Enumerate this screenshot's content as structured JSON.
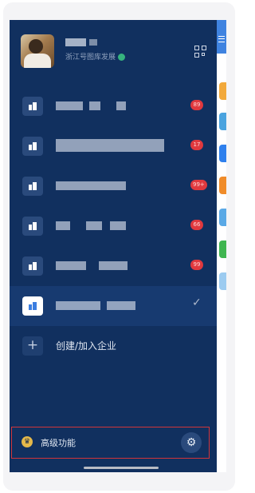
{
  "profile": {
    "company": "浙江号图库发展"
  },
  "organizations": [
    {
      "badge": "89",
      "selected": false
    },
    {
      "badge": "17",
      "selected": false
    },
    {
      "badge": "99+",
      "selected": false
    },
    {
      "badge": "66",
      "selected": false
    },
    {
      "badge": "99",
      "selected": false
    },
    {
      "badge": "",
      "selected": true
    }
  ],
  "create_org": {
    "label": "创建/加入企业"
  },
  "advanced": {
    "label": "高级功能"
  },
  "colors": {
    "drawer_bg": "#11305f",
    "selected_bg": "#173a70",
    "badge_red": "#e0393e",
    "highlight_border": "#d0353a",
    "accent_blue": "#3f83e0"
  },
  "icons": [
    "qr-code-icon",
    "building-icon",
    "checkmark-icon",
    "plus-icon",
    "crown-icon",
    "gear-icon",
    "verified-icon"
  ]
}
